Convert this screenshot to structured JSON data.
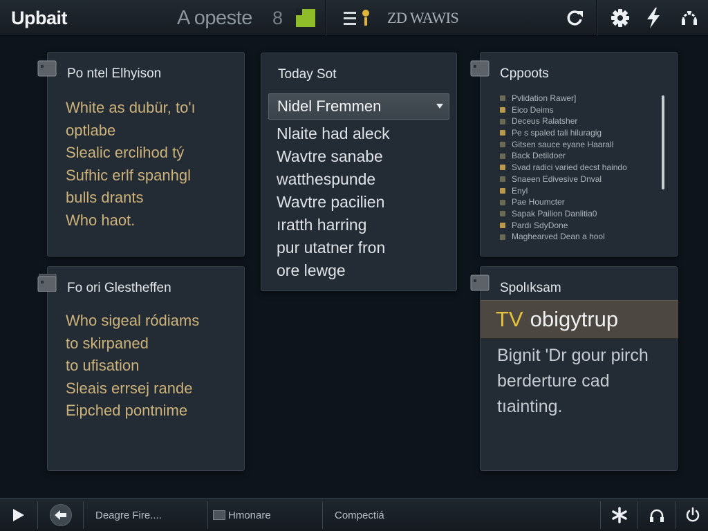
{
  "topbar": {
    "brand": "Upbait",
    "doc_title": "A opeste",
    "doc_number": "8",
    "view_label": "ZD WAWIS",
    "accent_color": "#8fbd2a",
    "icons": [
      "green-square-icon",
      "menu-settings-icon",
      "refresh-icon",
      "gear-icon",
      "bolt-icon",
      "connection-icon"
    ]
  },
  "panels": {
    "personal": {
      "title": "Po ntel Elhyison",
      "items": [
        "White as dubür, to'ı",
        "optlabe",
        "Slealic erclihod tý",
        "Sufhic erlf spanhgl",
        "bulls drants",
        "Who haot."
      ]
    },
    "today": {
      "title": "Today Sot",
      "select_value": "Nidel Fremmen",
      "items": [
        "Nlaite had aleck",
        "Wavtre sanabe",
        "watthespunde",
        "Wavtre pacilien",
        "ıratth harring",
        "pur utatner fron",
        "ore lewge"
      ]
    },
    "cppoots": {
      "title": "Cppoots",
      "items": [
        {
          "text": "Pvlidation Rawer]",
          "warm": false
        },
        {
          "text": "Eico Deims",
          "warm": true
        },
        {
          "text": "Deceus Ralatsher",
          "warm": false
        },
        {
          "text": "Pe s spaled tali hiluragig",
          "warm": true
        },
        {
          "text": "Gitsen sauce eyane Haarall",
          "warm": false
        },
        {
          "text": "Back Detildoer",
          "warm": false
        },
        {
          "text": "Svad radici varied decst haindo",
          "warm": true
        },
        {
          "text": "Snaeen Edivesive Dnval",
          "warm": false
        },
        {
          "text": "Enyl",
          "warm": true
        },
        {
          "text": "Pae Houmcter",
          "warm": false
        },
        {
          "text": "Sapak Pailion Danlitia0",
          "warm": false
        },
        {
          "text": "Pardı SdyDone",
          "warm": true
        },
        {
          "text": "Maghearved Dean a hool",
          "warm": false
        }
      ]
    },
    "foori": {
      "title": "Fo ori Glestheffen",
      "items": [
        "Who sigeal ródiams",
        "to skirpaned",
        "to ufisation",
        "Sleais errsej rande",
        "Eipched pontnime"
      ]
    },
    "spolksam": {
      "title": "Spolıksam",
      "highlight_tag": "TV",
      "highlight_text": "obigytrup",
      "lines": [
        "Bignit 'Dr gour pirch",
        "berderture cad",
        "tıainting."
      ]
    }
  },
  "bottombar": {
    "status_1": "Deagre Fire....",
    "status_2": "Hmonare",
    "status_3": "Compectiá",
    "icons": [
      "play-icon",
      "back-arrow-icon",
      "folder-icon",
      "asterisk-icon",
      "headphones-icon",
      "power-icon"
    ]
  }
}
